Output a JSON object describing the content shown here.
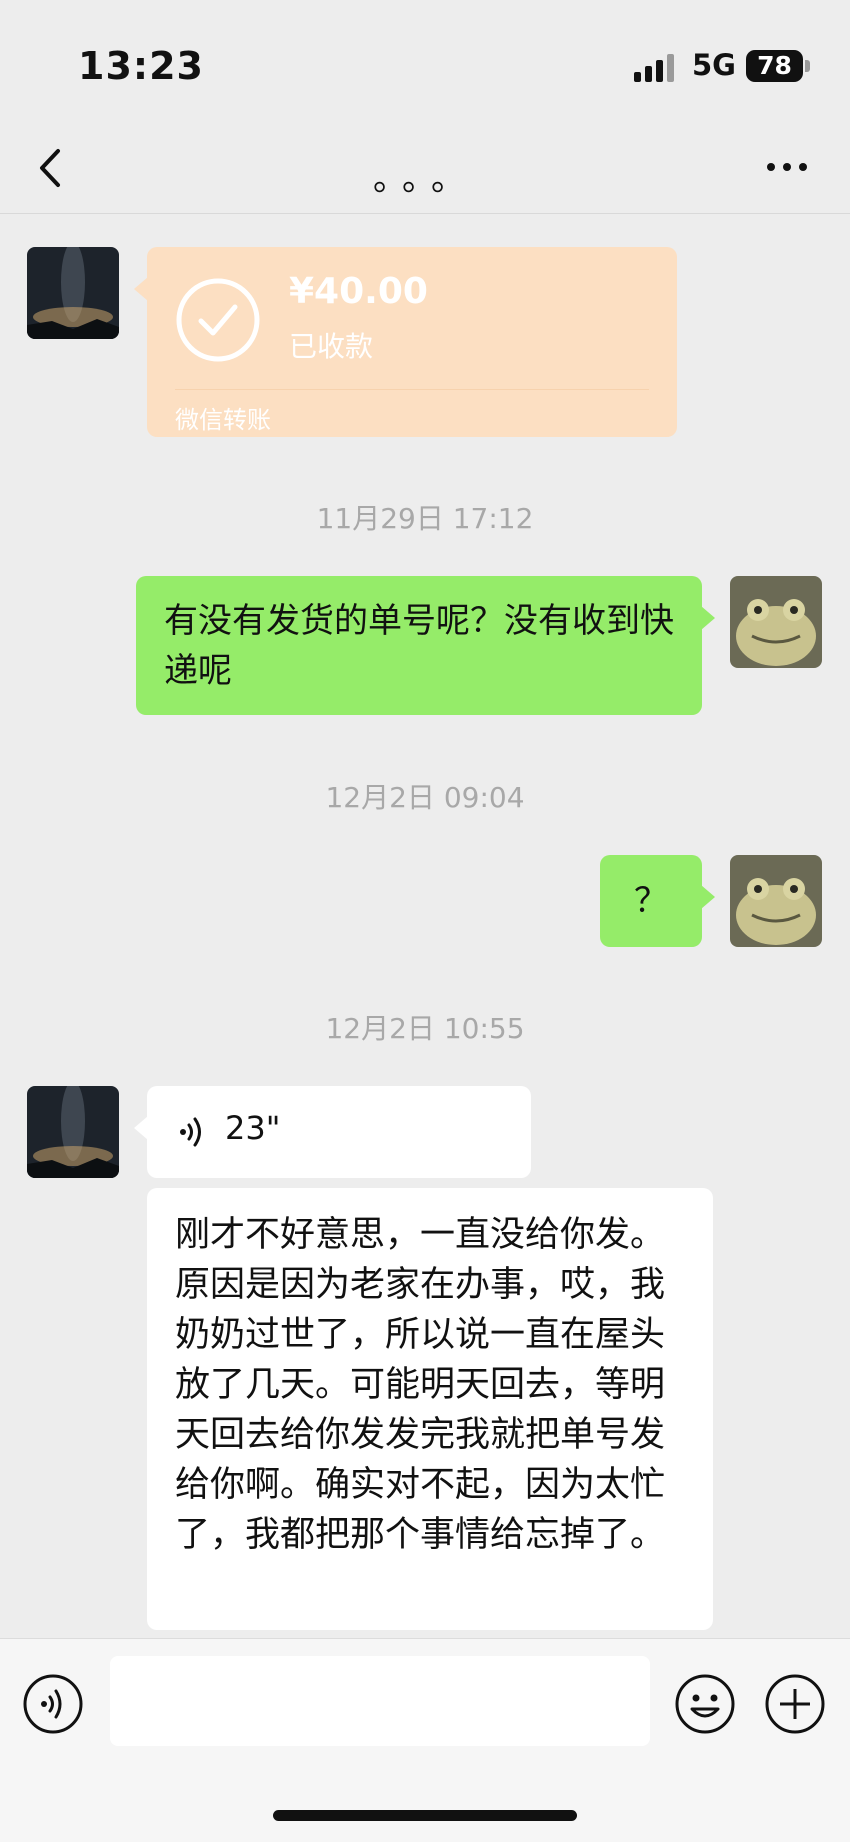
{
  "status_bar": {
    "time": "13:23",
    "network": "5G",
    "battery": "78"
  },
  "nav": {
    "title": "。。。"
  },
  "messages": {
    "transfer": {
      "amount": "¥40.00",
      "status": "已收款",
      "brand": "微信转账"
    },
    "timestamp1": "11月29日 17:12",
    "msg1": "有没有发货的单号呢？没有收到快递呢",
    "timestamp2": "12月2日 09:04",
    "msg2": "？",
    "timestamp3": "12月2日 10:55",
    "voice": {
      "duration": "23\""
    },
    "msg3": "刚才不好意思，一直没给你发。原因是因为老家在办事，哎，我奶奶过世了，所以说一直在屋头放了几天。可能明天回去，等明天回去给你发发完我就把单号发给你啊。确实对不起，因为太忙了，我都把那个事情给忘掉了。"
  },
  "input": {
    "value": ""
  },
  "colors": {
    "background": "#ededed",
    "green_bubble": "#95ec69",
    "transfer": "#fcdfc2"
  }
}
